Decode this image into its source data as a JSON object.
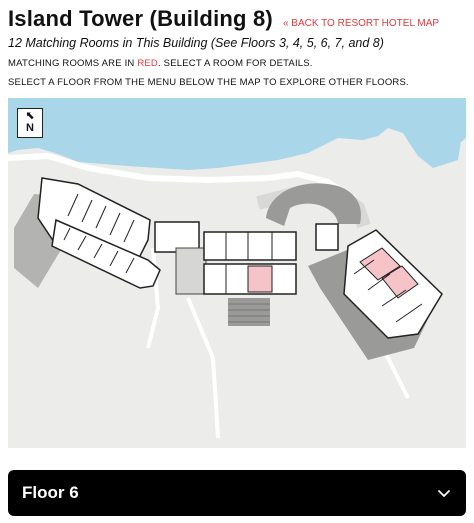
{
  "header": {
    "title": "Island Tower (Building 8)",
    "back_link": "« BACK TO RESORT HOTEL MAP",
    "subtitle": "12 Matching Rooms in This Building (See Floors 3, 4, 5, 6, 7, and 8)",
    "info_prefix": "MATCHING ROOMS ARE IN ",
    "info_highlight": "RED",
    "info_suffix": ". SELECT A ROOM FOR DETAILS.",
    "instruction": "SELECT A FLOOR FROM THE MENU BELOW THE MAP TO EXPLORE OTHER FLOORS."
  },
  "map": {
    "north_arrow": "⬉",
    "north_label": "N"
  },
  "floor_selector": {
    "selected": "Floor 6",
    "icon": "chevron-down-icon"
  },
  "colors": {
    "accent_red": "#e0393e",
    "matching_room": "#f6c3c8",
    "water": "#a9d6e8",
    "selector_bg": "#000000"
  }
}
